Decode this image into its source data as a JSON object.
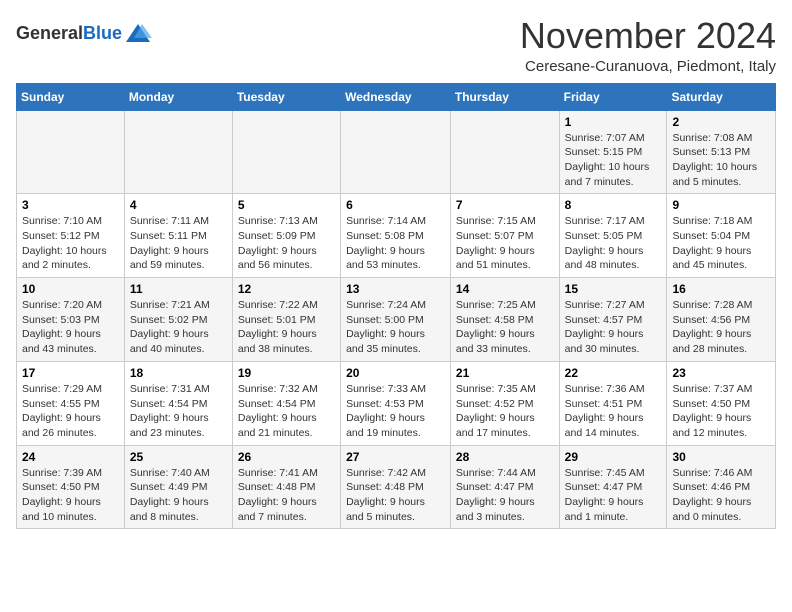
{
  "header": {
    "logo_general": "General",
    "logo_blue": "Blue",
    "month_title": "November 2024",
    "location": "Ceresane-Curanuova, Piedmont, Italy"
  },
  "days_of_week": [
    "Sunday",
    "Monday",
    "Tuesday",
    "Wednesday",
    "Thursday",
    "Friday",
    "Saturday"
  ],
  "weeks": [
    [
      {
        "day": "",
        "info": ""
      },
      {
        "day": "",
        "info": ""
      },
      {
        "day": "",
        "info": ""
      },
      {
        "day": "",
        "info": ""
      },
      {
        "day": "",
        "info": ""
      },
      {
        "day": "1",
        "info": "Sunrise: 7:07 AM\nSunset: 5:15 PM\nDaylight: 10 hours and 7 minutes."
      },
      {
        "day": "2",
        "info": "Sunrise: 7:08 AM\nSunset: 5:13 PM\nDaylight: 10 hours and 5 minutes."
      }
    ],
    [
      {
        "day": "3",
        "info": "Sunrise: 7:10 AM\nSunset: 5:12 PM\nDaylight: 10 hours and 2 minutes."
      },
      {
        "day": "4",
        "info": "Sunrise: 7:11 AM\nSunset: 5:11 PM\nDaylight: 9 hours and 59 minutes."
      },
      {
        "day": "5",
        "info": "Sunrise: 7:13 AM\nSunset: 5:09 PM\nDaylight: 9 hours and 56 minutes."
      },
      {
        "day": "6",
        "info": "Sunrise: 7:14 AM\nSunset: 5:08 PM\nDaylight: 9 hours and 53 minutes."
      },
      {
        "day": "7",
        "info": "Sunrise: 7:15 AM\nSunset: 5:07 PM\nDaylight: 9 hours and 51 minutes."
      },
      {
        "day": "8",
        "info": "Sunrise: 7:17 AM\nSunset: 5:05 PM\nDaylight: 9 hours and 48 minutes."
      },
      {
        "day": "9",
        "info": "Sunrise: 7:18 AM\nSunset: 5:04 PM\nDaylight: 9 hours and 45 minutes."
      }
    ],
    [
      {
        "day": "10",
        "info": "Sunrise: 7:20 AM\nSunset: 5:03 PM\nDaylight: 9 hours and 43 minutes."
      },
      {
        "day": "11",
        "info": "Sunrise: 7:21 AM\nSunset: 5:02 PM\nDaylight: 9 hours and 40 minutes."
      },
      {
        "day": "12",
        "info": "Sunrise: 7:22 AM\nSunset: 5:01 PM\nDaylight: 9 hours and 38 minutes."
      },
      {
        "day": "13",
        "info": "Sunrise: 7:24 AM\nSunset: 5:00 PM\nDaylight: 9 hours and 35 minutes."
      },
      {
        "day": "14",
        "info": "Sunrise: 7:25 AM\nSunset: 4:58 PM\nDaylight: 9 hours and 33 minutes."
      },
      {
        "day": "15",
        "info": "Sunrise: 7:27 AM\nSunset: 4:57 PM\nDaylight: 9 hours and 30 minutes."
      },
      {
        "day": "16",
        "info": "Sunrise: 7:28 AM\nSunset: 4:56 PM\nDaylight: 9 hours and 28 minutes."
      }
    ],
    [
      {
        "day": "17",
        "info": "Sunrise: 7:29 AM\nSunset: 4:55 PM\nDaylight: 9 hours and 26 minutes."
      },
      {
        "day": "18",
        "info": "Sunrise: 7:31 AM\nSunset: 4:54 PM\nDaylight: 9 hours and 23 minutes."
      },
      {
        "day": "19",
        "info": "Sunrise: 7:32 AM\nSunset: 4:54 PM\nDaylight: 9 hours and 21 minutes."
      },
      {
        "day": "20",
        "info": "Sunrise: 7:33 AM\nSunset: 4:53 PM\nDaylight: 9 hours and 19 minutes."
      },
      {
        "day": "21",
        "info": "Sunrise: 7:35 AM\nSunset: 4:52 PM\nDaylight: 9 hours and 17 minutes."
      },
      {
        "day": "22",
        "info": "Sunrise: 7:36 AM\nSunset: 4:51 PM\nDaylight: 9 hours and 14 minutes."
      },
      {
        "day": "23",
        "info": "Sunrise: 7:37 AM\nSunset: 4:50 PM\nDaylight: 9 hours and 12 minutes."
      }
    ],
    [
      {
        "day": "24",
        "info": "Sunrise: 7:39 AM\nSunset: 4:50 PM\nDaylight: 9 hours and 10 minutes."
      },
      {
        "day": "25",
        "info": "Sunrise: 7:40 AM\nSunset: 4:49 PM\nDaylight: 9 hours and 8 minutes."
      },
      {
        "day": "26",
        "info": "Sunrise: 7:41 AM\nSunset: 4:48 PM\nDaylight: 9 hours and 7 minutes."
      },
      {
        "day": "27",
        "info": "Sunrise: 7:42 AM\nSunset: 4:48 PM\nDaylight: 9 hours and 5 minutes."
      },
      {
        "day": "28",
        "info": "Sunrise: 7:44 AM\nSunset: 4:47 PM\nDaylight: 9 hours and 3 minutes."
      },
      {
        "day": "29",
        "info": "Sunrise: 7:45 AM\nSunset: 4:47 PM\nDaylight: 9 hours and 1 minute."
      },
      {
        "day": "30",
        "info": "Sunrise: 7:46 AM\nSunset: 4:46 PM\nDaylight: 9 hours and 0 minutes."
      }
    ]
  ]
}
